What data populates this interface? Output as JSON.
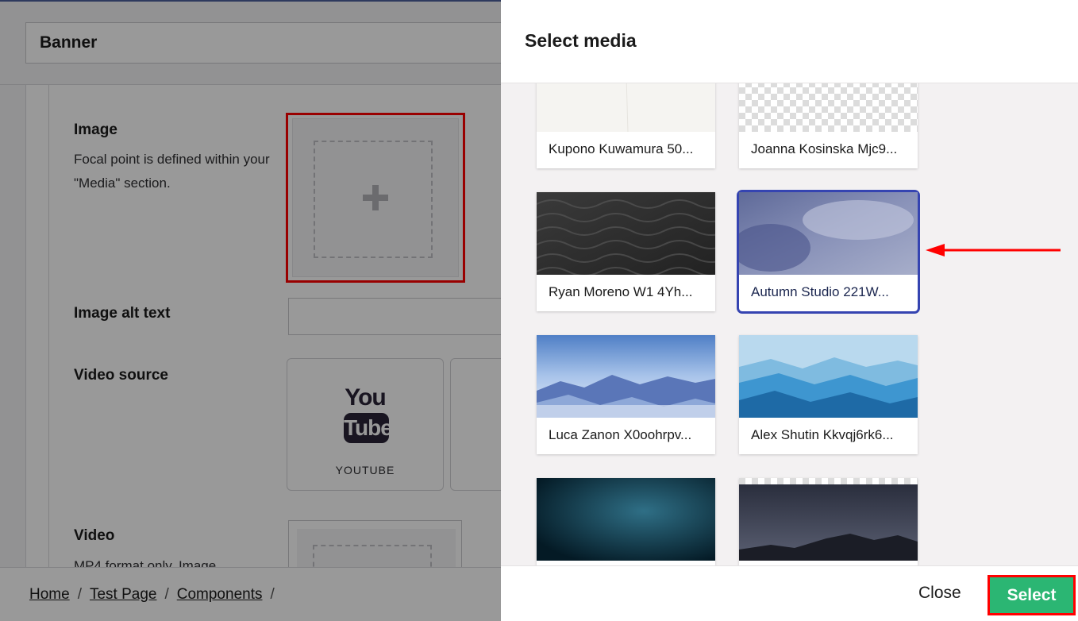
{
  "editor": {
    "title": "Banner",
    "fields": {
      "image": {
        "label": "Image",
        "description": "Focal point is defined within your \"Media\" section.",
        "add_icon": "plus-icon"
      },
      "image_alt": {
        "label": "Image alt text",
        "value": ""
      },
      "video_source": {
        "label": "Video source",
        "options": [
          {
            "logo_top": "You",
            "logo_bottom": "Tube",
            "label": "YOUTUBE",
            "icon": "youtube-logo-icon"
          }
        ]
      },
      "video": {
        "label": "Video",
        "description": "MP4 format only. Image"
      }
    },
    "breadcrumb": [
      "Home",
      "Test Page",
      "Components"
    ],
    "breadcrumb_separator": "/"
  },
  "dialog": {
    "title": "Select media",
    "items": [
      {
        "caption": "Kupono Kuwamura 50...",
        "selected": false
      },
      {
        "caption": "Joanna Kosinska Mjc9...",
        "selected": false
      },
      {
        "caption": "Ryan Moreno W1 4Yh...",
        "selected": false
      },
      {
        "caption": "Autumn Studio 221W...",
        "selected": true
      },
      {
        "caption": "Luca Zanon X0oohrpv...",
        "selected": false
      },
      {
        "caption": "Alex Shutin Kkvqj6rk6...",
        "selected": false
      },
      {
        "caption": "",
        "selected": false
      },
      {
        "caption": "",
        "selected": false
      }
    ],
    "close_label": "Close",
    "select_label": "Select"
  },
  "colors": {
    "accent_green": "#2bb673",
    "selection_blue": "#3544b1",
    "annotation_red": "#ff0000"
  }
}
